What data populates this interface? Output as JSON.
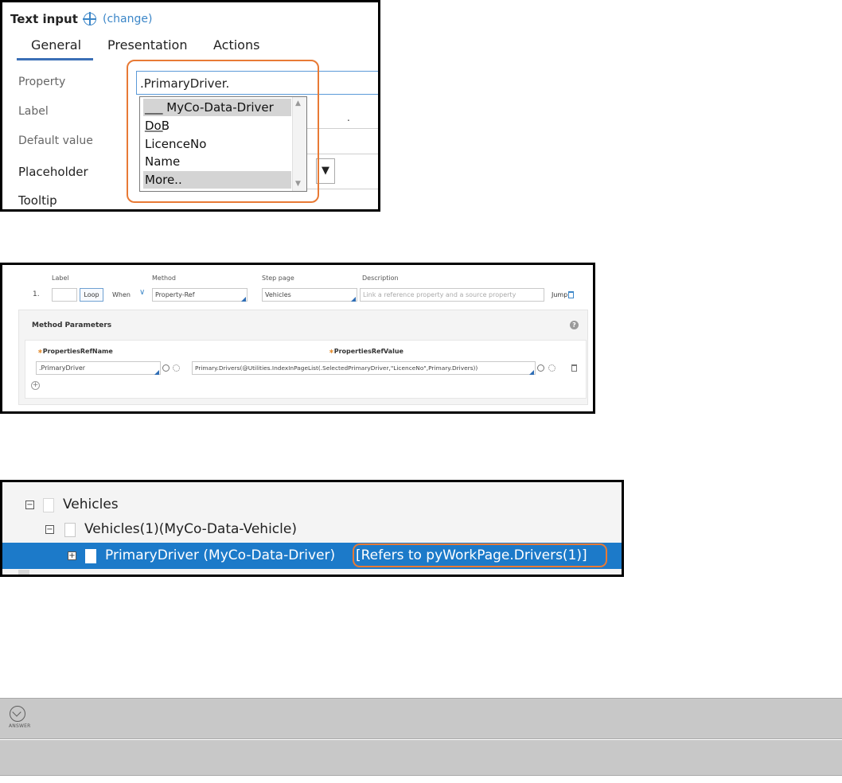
{
  "panel1": {
    "title": "Text input",
    "change_link": "(change)",
    "tabs": [
      "General",
      "Presentation",
      "Actions"
    ],
    "labels": {
      "property": "Property",
      "label": "Label",
      "default_value": "Default value",
      "placeholder": "Placeholder",
      "tooltip": "Tooltip"
    },
    "property_value": ".PrimaryDriver.",
    "dropdown_items": [
      "___ MyCo-Data-Driver ___",
      "DoB",
      "LicenceNo",
      "Name",
      "More.."
    ],
    "label_dot": ".",
    "placeholder_select_glyph": "▼"
  },
  "panel2": {
    "headers": {
      "label": "Label",
      "method": "Method",
      "step_page": "Step page",
      "description": "Description"
    },
    "row_number": "1.",
    "loop_button": "Loop",
    "when_label": "When",
    "method_value": "Property-Ref",
    "step_page_value": "Vehicles",
    "description_placeholder": "Link a reference property and a source property",
    "jump_label": "Jump",
    "method_parameters_title": "Method Parameters",
    "help_glyph": "?",
    "param_names": [
      "PropertiesRefName",
      "PropertiesRefValue"
    ],
    "param_name_value": ".PrimaryDriver",
    "param_value_value": "Primary.Drivers(@Utilities.IndexInPageList(.SelectedPrimaryDriver,\"LicenceNo\",Primary.Drivers))",
    "add_glyph": "+"
  },
  "panel3": {
    "toggles": {
      "collapse": "−",
      "expand": "+"
    },
    "rows": [
      {
        "text": "Vehicles"
      },
      {
        "text": "Vehicles(1)(MyCo-Data-Vehicle)"
      },
      {
        "text": "PrimaryDriver (MyCo-Data-Driver)",
        "ref": "[Refers to pyWorkPage.Drivers(1)]"
      }
    ],
    "highlight_color": "#1c7ac9"
  },
  "answer": {
    "label": "ANSWER"
  },
  "colors": {
    "accent_blue": "#3b86c8",
    "highlight_orange": "#e87a35",
    "selection_blue": "#1c7ac9"
  }
}
